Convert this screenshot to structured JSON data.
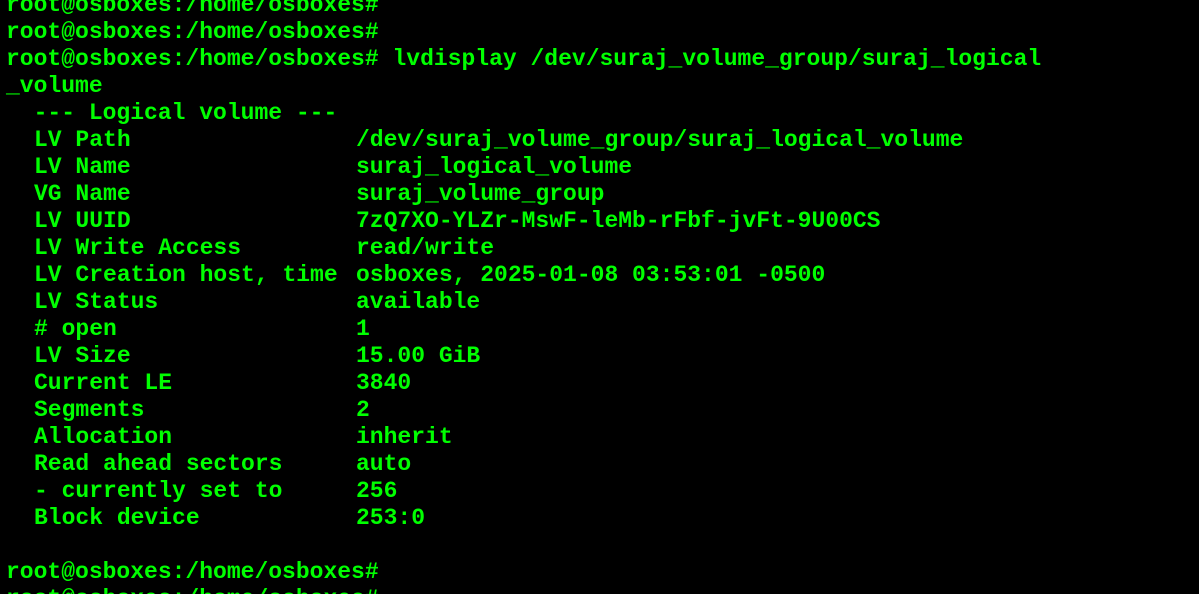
{
  "colors": {
    "background": "#000000",
    "foreground": "#00ff00"
  },
  "terminal": {
    "history": [
      "root@osboxes:/home/osboxes#",
      "root@osboxes:/home/osboxes#"
    ],
    "command_prompt": "root@osboxes:/home/osboxes#",
    "command_text": " lvdisplay /dev/suraj_volume_group/suraj_logical",
    "command_wrap": "_volume",
    "section_header": "  --- Logical volume ---",
    "fields": [
      {
        "label": "LV Path",
        "value": "/dev/suraj_volume_group/suraj_logical_volume"
      },
      {
        "label": "LV Name",
        "value": "suraj_logical_volume"
      },
      {
        "label": "VG Name",
        "value": "suraj_volume_group"
      },
      {
        "label": "LV UUID",
        "value": "7zQ7XO-YLZr-MswF-leMb-rFbf-jvFt-9U00CS"
      },
      {
        "label": "LV Write Access",
        "value": "read/write"
      },
      {
        "label": "LV Creation host, time",
        "value": "osboxes, 2025-01-08 03:53:01 -0500"
      },
      {
        "label": "LV Status",
        "value": "available"
      },
      {
        "label": "# open",
        "value": "1"
      },
      {
        "label": "LV Size",
        "value": "15.00 GiB"
      },
      {
        "label": "Current LE",
        "value": "3840"
      },
      {
        "label": "Segments",
        "value": "2"
      },
      {
        "label": "Allocation",
        "value": "inherit"
      },
      {
        "label": "Read ahead sectors",
        "value": "auto"
      },
      {
        "label": "- currently set to",
        "value": "256"
      },
      {
        "label": "Block device",
        "value": "253:0"
      }
    ],
    "final_prompts": [
      "root@osboxes:/home/osboxes#",
      "root@osboxes:/home/osboxes#"
    ]
  }
}
